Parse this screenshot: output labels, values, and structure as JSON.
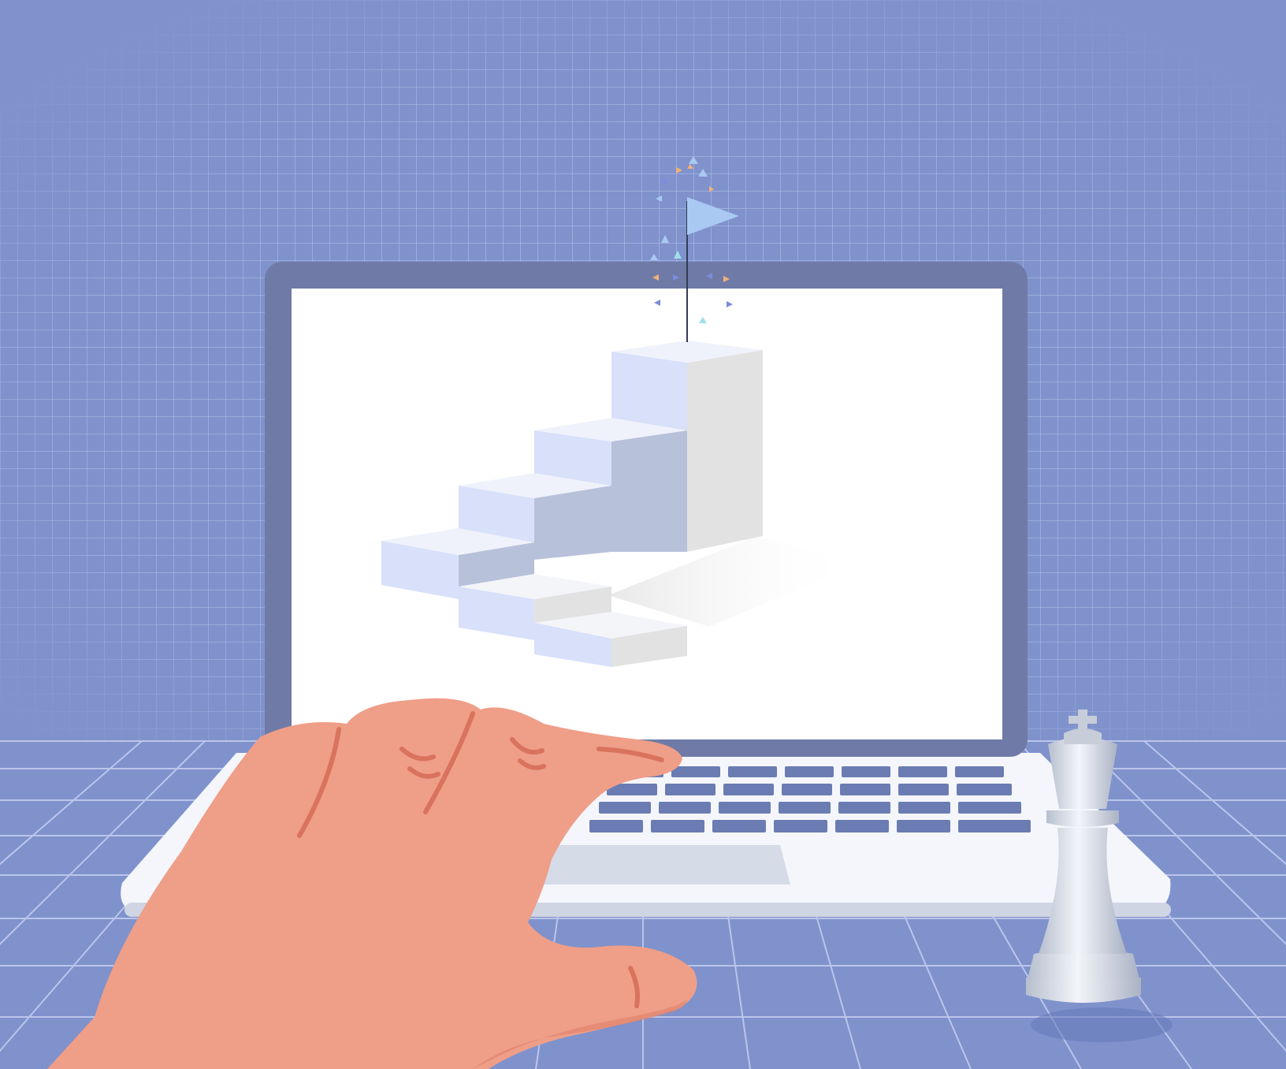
{
  "scene": {
    "description_visible_text": "",
    "colors": {
      "background": "#7f92cc",
      "grid_line": "#c5cff0",
      "laptop_bezel": "#6f7ba6",
      "screen": "#ffffff",
      "laptop_base": "#f4f6fb",
      "keyboard_key": "#6b7cb3",
      "trackpad": "#d6dbe8",
      "hand": "#ef9e88",
      "hand_shadow": "#d9735d",
      "stair_light": "#d8e0fa",
      "stair_mid": "#b8c1da",
      "stair_side": "#e6e6e6",
      "flag": "#a9c8f2",
      "chess_king": "#d7dce6"
    },
    "icons": [
      "laptop-icon",
      "stairs-icon",
      "flag-icon",
      "hand-icon",
      "chess-king-icon",
      "confetti-icon"
    ]
  }
}
